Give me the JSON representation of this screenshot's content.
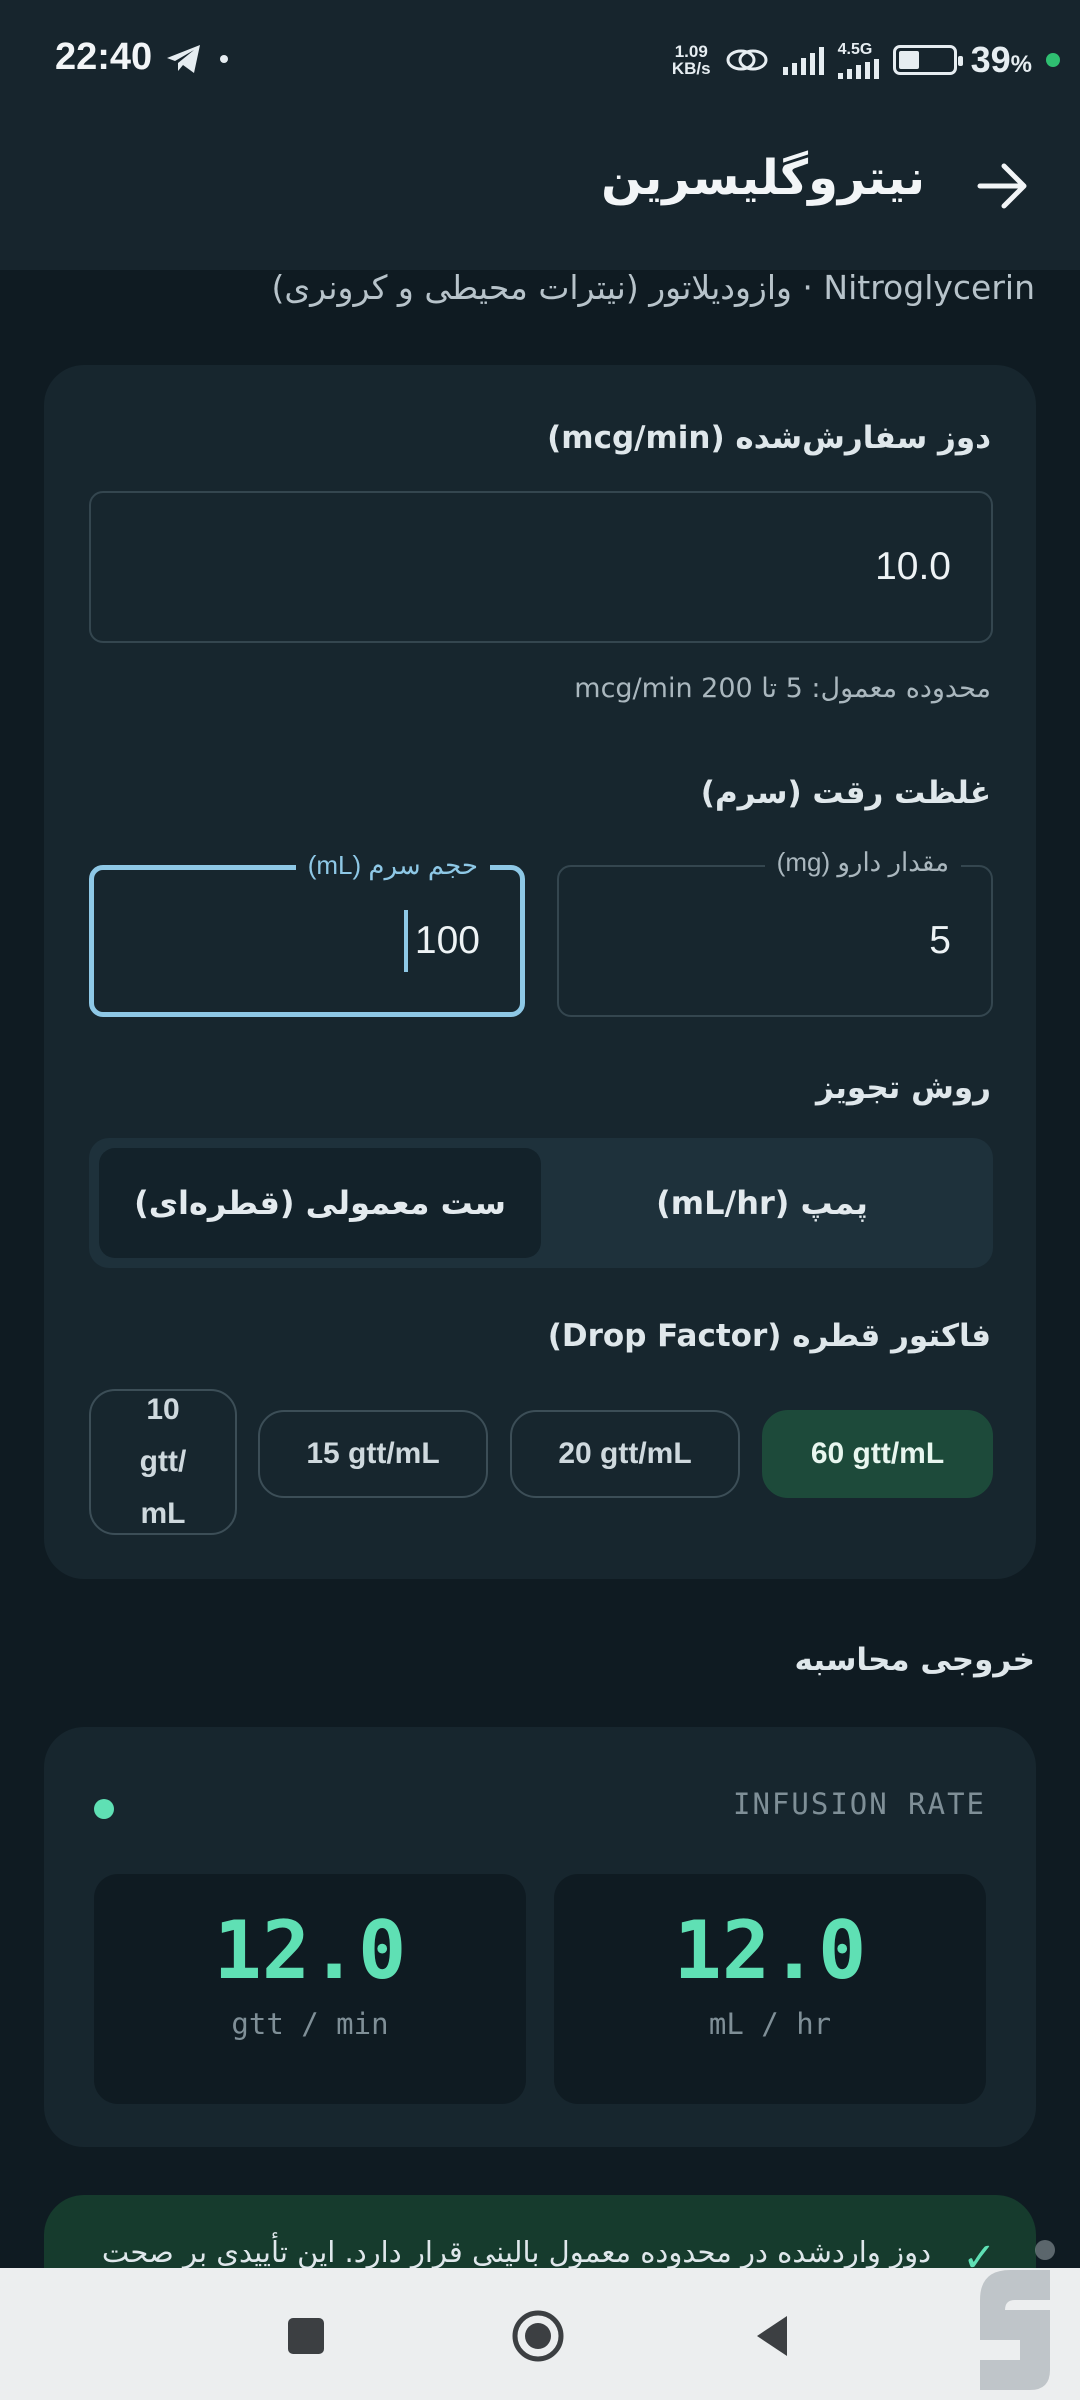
{
  "status": {
    "time": "22:40",
    "net_speed_value": "1.09",
    "net_speed_unit": "KB/s",
    "network_type": "4.5G",
    "battery": "39",
    "battery_unit": "%"
  },
  "header": {
    "title": "نیتروگلیسرین",
    "subtitle": "Nitroglycerin · وازودیلاتور (نیترات محیطی و کرونری)"
  },
  "form": {
    "dose": {
      "label": "دوز سفارش‌شده (mcg/min)",
      "value": "10.0",
      "helper": "محدوده معمول: 5 تا 200 mcg/min"
    },
    "concentration": {
      "label": "غلظت رقت (سرم)",
      "drug_amount_label": "مقدار دارو (mg)",
      "drug_amount_value": "5",
      "volume_label": "حجم سرم (mL)",
      "volume_value": "100"
    },
    "method": {
      "label": "روش تجویز",
      "options": [
        "پمپ (mL/hr)",
        "ست معمولی (قطره‌ای)"
      ],
      "selected": "ست معمولی (قطره‌ای)"
    },
    "drop_factor": {
      "label": "فاکتور قطره (Drop Factor)",
      "options": [
        "60 gtt/mL",
        "20 gtt/mL",
        "15 gtt/mL"
      ],
      "last_option_lines": [
        "10",
        "gtt/",
        "mL"
      ],
      "selected": "60 gtt/mL"
    }
  },
  "results": {
    "section_title": "خروجی محاسبه",
    "caption": "INFUSION RATE",
    "ml_hr_value": "12.0",
    "ml_hr_unit": "mL / hr",
    "gtt_min_value": "12.0",
    "gtt_min_unit": "gtt / min"
  },
  "notice": {
    "text": "دوز واردشده در محدوده معمول بالینی قرار دارد. این تأییدی بر صحت"
  },
  "colors": {
    "background": "#0f1b22",
    "card": "#17262e",
    "accent": "#5fe0b4",
    "focus": "#8ec8e6",
    "selected_chip": "#1d4a3a"
  }
}
